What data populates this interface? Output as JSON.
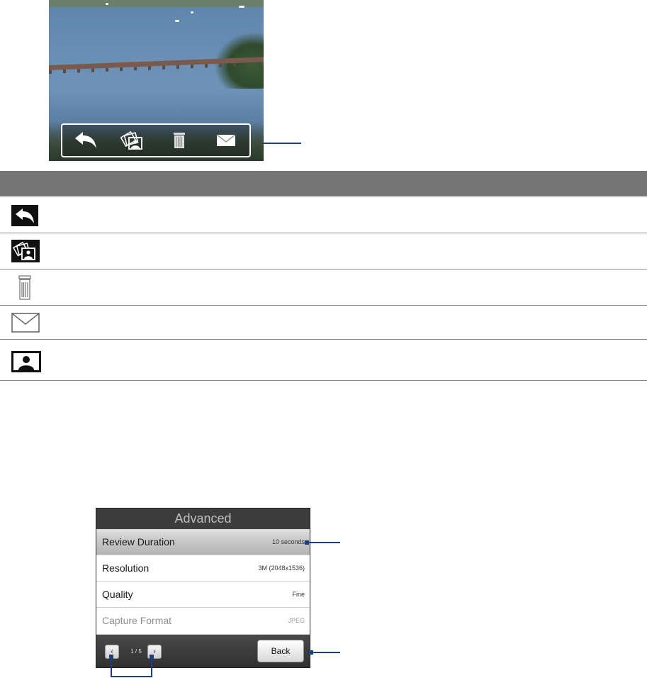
{
  "review_screen": {
    "toolbar": {
      "buttons": [
        {
          "name": "back",
          "icon": "back-arrow-icon"
        },
        {
          "name": "album",
          "icon": "album-icon"
        },
        {
          "name": "delete",
          "icon": "trash-icon"
        },
        {
          "name": "send",
          "icon": "mail-icon"
        }
      ]
    }
  },
  "icon_table": {
    "header": "",
    "rows": [
      {
        "icon": "back-arrow-icon",
        "text": ""
      },
      {
        "icon": "album-icon",
        "text": ""
      },
      {
        "icon": "trash-icon",
        "text": ""
      },
      {
        "icon": "mail-icon",
        "text": ""
      },
      {
        "icon": "contact-picture-icon",
        "text": ""
      }
    ]
  },
  "advanced_screen": {
    "title": "Advanced",
    "rows": [
      {
        "label": "Review Duration",
        "value": "10 seconds",
        "selected": true
      },
      {
        "label": "Resolution",
        "value": "3M (2048x1536)"
      },
      {
        "label": "Quality",
        "value": "Fine"
      },
      {
        "label": "Capture Format",
        "value": "JPEG",
        "dimmed": true
      }
    ],
    "page_indicator": "1 / 5",
    "back_label": "Back"
  },
  "colors": {
    "accent_callout": "#1a3f82",
    "table_header": "#757575",
    "screen_background": "#3c3c3c"
  }
}
